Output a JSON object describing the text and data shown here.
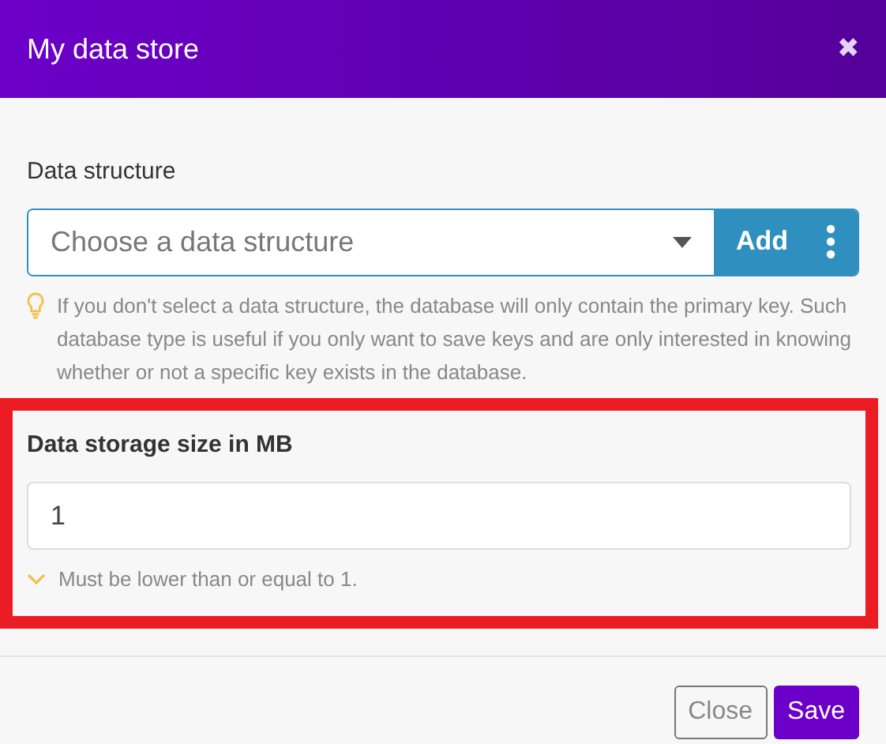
{
  "window": {
    "title": "My data store",
    "close_label": "✖"
  },
  "data_structure": {
    "label": "Data structure",
    "placeholder": "Choose a data structure",
    "add_button": "Add",
    "hint": "If you don't select a data structure, the database will only contain the primary key. Such database type is useful if you only want to save keys and are only interested in knowing whether or not a specific key exists in the database."
  },
  "storage_size": {
    "label": "Data storage size in MB",
    "value": "1",
    "hint": "Must be lower than or equal to 1.",
    "highlighted": true
  },
  "buttons": [
    {
      "label": "Close",
      "kind": "secondary"
    },
    {
      "label": "Save",
      "kind": "primary"
    }
  ]
}
